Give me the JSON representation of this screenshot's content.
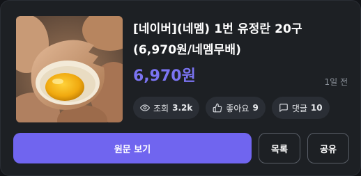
{
  "product": {
    "title_line1": "[네이버](네멤) 1번 유정란 20구",
    "title_line2": "(6,970원/네멤무배)",
    "price": "6,970원",
    "time_ago": "1일 전",
    "image_icon": "egg-photo"
  },
  "stats": {
    "views_label": "조회",
    "views_value": "3.2k",
    "likes_label": "좋아요",
    "likes_value": "9",
    "comments_label": "댓글",
    "comments_value": "10"
  },
  "actions": {
    "view_original": "원문 보기",
    "list": "목록",
    "share": "공유"
  },
  "colors": {
    "accent": "#7065ef",
    "price": "#7b74f2",
    "card_bg": "#1d2024",
    "pill_bg": "#2a2e35"
  }
}
